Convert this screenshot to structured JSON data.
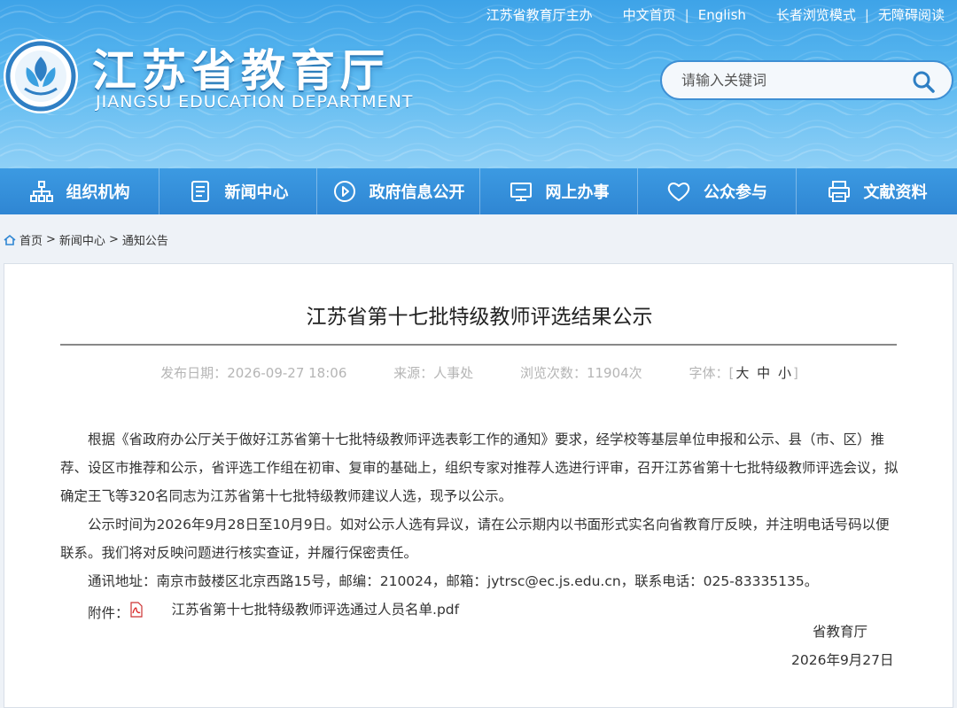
{
  "top_links": {
    "host": "江苏省教育厅主办",
    "chinese": "中文首页",
    "english": "English",
    "elder_mode": "长者浏览模式",
    "accessibility": "无障碍阅读"
  },
  "brand": {
    "title_cn": "江苏省教育厅",
    "title_en": "JIANGSU EDUCATION DEPARTMENT"
  },
  "search": {
    "placeholder": "请输入关键词"
  },
  "nav": [
    {
      "label": "组织机构",
      "icon": "org-chart-icon"
    },
    {
      "label": "新闻中心",
      "icon": "document-icon"
    },
    {
      "label": "政府信息公开",
      "icon": "play-circle-icon"
    },
    {
      "label": "网上办事",
      "icon": "monitor-icon"
    },
    {
      "label": "公众参与",
      "icon": "heart-icon"
    },
    {
      "label": "文献资料",
      "icon": "printer-icon"
    }
  ],
  "breadcrumb": {
    "home": "首页",
    "sep1": ">",
    "news": "新闻中心",
    "sep2": ">",
    "current": "通知公告"
  },
  "article": {
    "title": "江苏省第十七批特级教师评选结果公示",
    "date_label": "发布日期：",
    "date": "2026-09-27 18:06",
    "source_label": "来源：",
    "source": "人事处",
    "views_label": "浏览次数：",
    "views": "11904次",
    "font_label": "字体：",
    "font_open": "[",
    "font_big": "大",
    "font_mid": "中",
    "font_small": "小",
    "font_close": "]",
    "para1": "根据《省政府办公厅关于做好江苏省第十七批特级教师评选表彰工作的通知》要求，经学校等基层单位申报和公示、县（市、区）推荐、设区市推荐和公示，省评选工作组在初审、复审的基础上，组织专家对推荐人选进行评审，召开江苏省第十七批特级教师评选会议，拟确定王飞等320名同志为江苏省第十七批特级教师建议人选，现予以公示。",
    "para2": "公示时间为2026年9月28日至10月9日。如对公示人选有异议，请在公示期内以书面形式实名向省教育厅反映，并注明电话号码以便联系。我们将对反映问题进行核实查证，并履行保密责任。",
    "para3": "通讯地址：南京市鼓楼区北京西路15号，邮编：210024，邮箱：jytrsc@ec.js.edu.cn，联系电话：025-83335135。",
    "attach_label": "附件：",
    "attach_file": "江苏省第十七批特级教师评选通过人员名单.pdf",
    "sign_org": "省教育厅",
    "sign_date": "2026年9月27日"
  }
}
